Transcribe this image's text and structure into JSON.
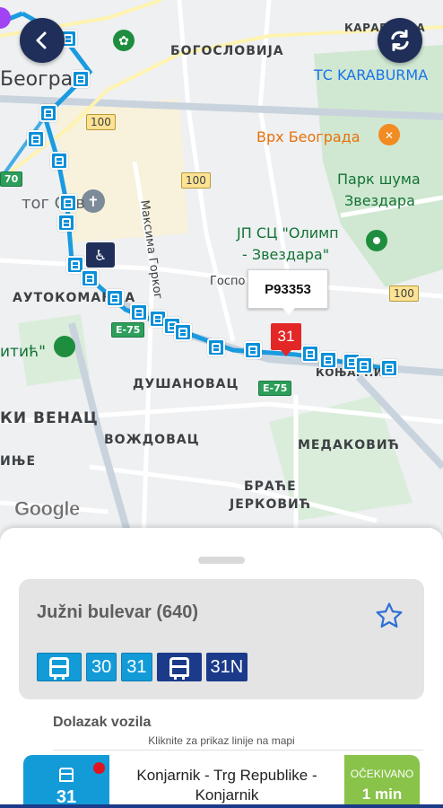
{
  "map": {
    "labels": {
      "bogoslovija": "БОГОСЛОВИЈА",
      "karaburma": "КАРАБУРМА",
      "beograd": "Београ",
      "tc_karaburma": "ТС KARABURMA",
      "vrh_beograda": "Врх Београда",
      "park_sume_1": "Парк шума",
      "park_sume_2": "Звездара",
      "jp_sc_1": "ЈП СЦ \"Олимп",
      "jp_sc_2": "- Звездара\"",
      "hram_sv_save": "тог Сав",
      "maksima_gorkog": "Максима Горког",
      "gospo": "Госпо",
      "autokomanda": "АУТОКОМАНДА",
      "titic": "итић\"",
      "dusanovac": "ДУШАНОВАЦ",
      "konjarnik": "КОЊАРНИК",
      "ki_venac": "КИ ВЕНАЦ",
      "vozdovac": "ВОЖДОВАЦ",
      "medakovic": "МЕДАКОВИЋ",
      "inje": "ИЊЕ",
      "brace_1": "БРАЋЕ",
      "brace_2": "ЈЕРКОВИЋ"
    },
    "shields": {
      "r100a": "100",
      "r100b": "100",
      "r100c": "100",
      "e75a": "E-75",
      "e75b": "E-75",
      "r70": "70"
    },
    "callout_vehicle_id": "P93353",
    "vehicle_line": "31",
    "google_logo": "Google",
    "colors": {
      "route": "#1a9be0",
      "pin": "#e32626",
      "nav_button": "#1f2f59"
    }
  },
  "controls": {
    "back_icon": "chevron-left-icon",
    "refresh_icon": "refresh-icon"
  },
  "stop": {
    "title": "Južni bulevar (640)",
    "favorite_icon": "star-outline-icon",
    "lines": [
      {
        "type": "icon",
        "style": "light"
      },
      {
        "type": "num",
        "label": "30",
        "style": "light"
      },
      {
        "type": "num",
        "label": "31",
        "style": "light"
      },
      {
        "type": "icon",
        "style": "dark"
      },
      {
        "type": "num",
        "label": "31N",
        "style": "dark"
      }
    ]
  },
  "arrivals": {
    "title": "Dolazak vozila",
    "hint": "Kliknite za prikaz linije na mapi",
    "items": [
      {
        "line": "31",
        "destination": "Konjarnik - Trg Republike - Konjarnik",
        "eta_label": "OČEKIVANO",
        "eta_value": "1 min"
      }
    ]
  }
}
